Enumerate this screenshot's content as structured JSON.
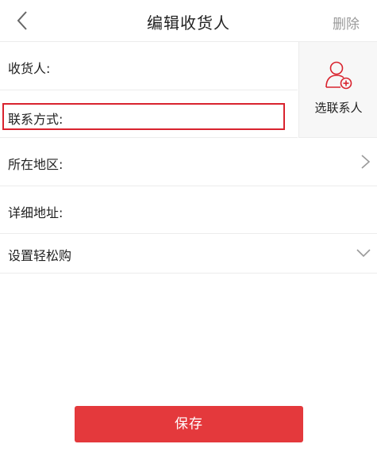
{
  "header": {
    "title": "编辑收货人",
    "delete_label": "删除",
    "back_icon": "chevron-left-icon"
  },
  "form": {
    "consignee_label": "收货人:",
    "contact_label": "联系方式:",
    "region_label": "所在地区:",
    "address_label": "详细地址:",
    "easybuy_label": "设置轻松购"
  },
  "contact_picker": {
    "label": "选联系人",
    "icon": "add-contact-icon"
  },
  "save_label": "保存",
  "colors": {
    "accent": "#e4393c",
    "highlight_border": "#d9232e",
    "muted_text": "#9a9a9a",
    "divider": "#ececec"
  }
}
